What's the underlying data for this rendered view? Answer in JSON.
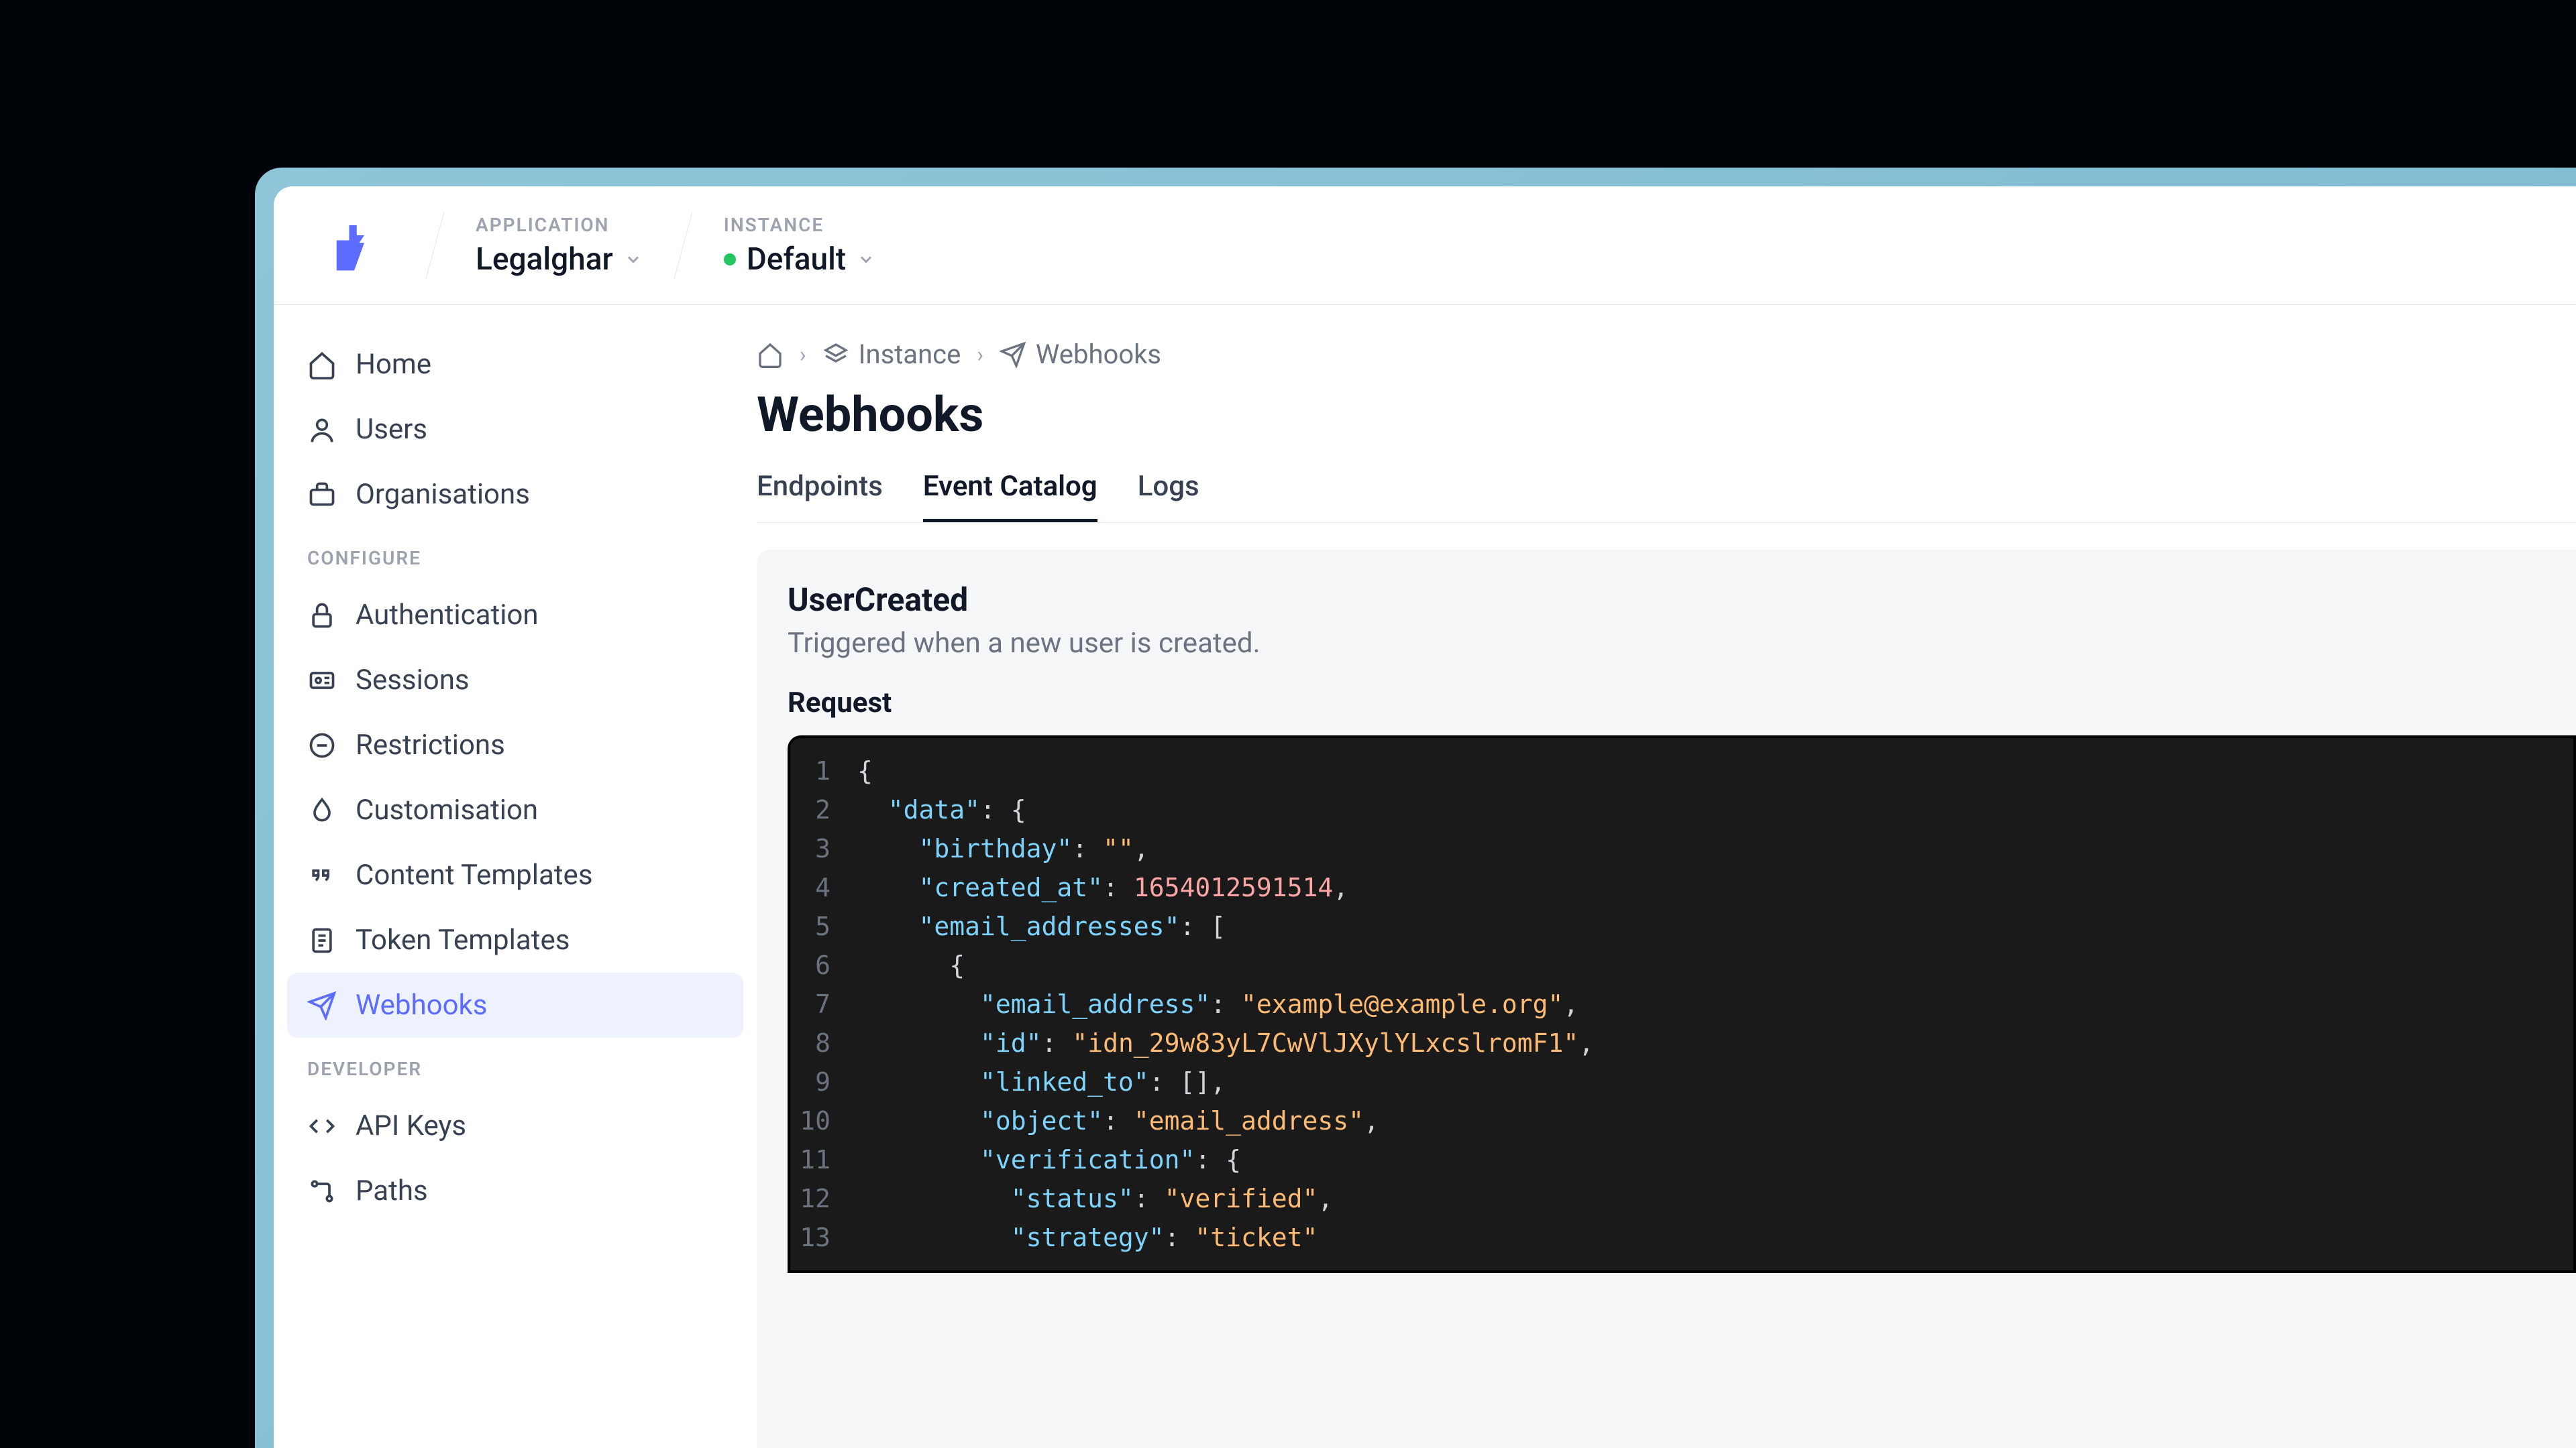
{
  "topbar": {
    "application_label": "APPLICATION",
    "application_value": "Legalghar",
    "instance_label": "INSTANCE",
    "instance_value": "Default"
  },
  "sidebar": {
    "main": [
      {
        "icon": "home",
        "label": "Home"
      },
      {
        "icon": "user",
        "label": "Users"
      },
      {
        "icon": "briefcase",
        "label": "Organisations"
      }
    ],
    "configure_label": "CONFIGURE",
    "configure": [
      {
        "icon": "lock",
        "label": "Authentication"
      },
      {
        "icon": "id",
        "label": "Sessions"
      },
      {
        "icon": "nope",
        "label": "Restrictions"
      },
      {
        "icon": "drop",
        "label": "Customisation"
      },
      {
        "icon": "quotes",
        "label": "Content Templates"
      },
      {
        "icon": "doc",
        "label": "Token Templates"
      },
      {
        "icon": "send",
        "label": "Webhooks",
        "active": true
      }
    ],
    "developer_label": "DEVELOPER",
    "developer": [
      {
        "icon": "code",
        "label": "API Keys"
      },
      {
        "icon": "paths",
        "label": "Paths"
      }
    ]
  },
  "breadcrumbs": {
    "instance": "Instance",
    "webhooks": "Webhooks"
  },
  "page": {
    "title": "Webhooks"
  },
  "tabs": [
    {
      "label": "Endpoints"
    },
    {
      "label": "Event Catalog",
      "active": true
    },
    {
      "label": "Logs"
    }
  ],
  "event": {
    "title": "UserCreated",
    "description": "Triggered when a new user is created.",
    "request_label": "Request"
  },
  "code": {
    "lines": [
      [
        {
          "t": "punct",
          "v": "{"
        }
      ],
      [
        {
          "t": "pad",
          "v": "  "
        },
        {
          "t": "key",
          "v": "\"data\""
        },
        {
          "t": "punct",
          "v": ": {"
        }
      ],
      [
        {
          "t": "pad",
          "v": "    "
        },
        {
          "t": "key",
          "v": "\"birthday\""
        },
        {
          "t": "punct",
          "v": ": "
        },
        {
          "t": "str",
          "v": "\"\""
        },
        {
          "t": "punct",
          "v": ","
        }
      ],
      [
        {
          "t": "pad",
          "v": "    "
        },
        {
          "t": "key",
          "v": "\"created_at\""
        },
        {
          "t": "punct",
          "v": ": "
        },
        {
          "t": "num",
          "v": "1654012591514"
        },
        {
          "t": "punct",
          "v": ","
        }
      ],
      [
        {
          "t": "pad",
          "v": "    "
        },
        {
          "t": "key",
          "v": "\"email_addresses\""
        },
        {
          "t": "punct",
          "v": ": ["
        }
      ],
      [
        {
          "t": "pad",
          "v": "      "
        },
        {
          "t": "punct",
          "v": "{"
        }
      ],
      [
        {
          "t": "pad",
          "v": "        "
        },
        {
          "t": "key",
          "v": "\"email_address\""
        },
        {
          "t": "punct",
          "v": ": "
        },
        {
          "t": "str",
          "v": "\"example@example.org\""
        },
        {
          "t": "punct",
          "v": ","
        }
      ],
      [
        {
          "t": "pad",
          "v": "        "
        },
        {
          "t": "key",
          "v": "\"id\""
        },
        {
          "t": "punct",
          "v": ": "
        },
        {
          "t": "str",
          "v": "\"idn_29w83yL7CwVlJXylYLxcslromF1\""
        },
        {
          "t": "punct",
          "v": ","
        }
      ],
      [
        {
          "t": "pad",
          "v": "        "
        },
        {
          "t": "key",
          "v": "\"linked_to\""
        },
        {
          "t": "punct",
          "v": ": [],"
        }
      ],
      [
        {
          "t": "pad",
          "v": "        "
        },
        {
          "t": "key",
          "v": "\"object\""
        },
        {
          "t": "punct",
          "v": ": "
        },
        {
          "t": "str",
          "v": "\"email_address\""
        },
        {
          "t": "punct",
          "v": ","
        }
      ],
      [
        {
          "t": "pad",
          "v": "        "
        },
        {
          "t": "key",
          "v": "\"verification\""
        },
        {
          "t": "punct",
          "v": ": {"
        }
      ],
      [
        {
          "t": "pad",
          "v": "          "
        },
        {
          "t": "key",
          "v": "\"status\""
        },
        {
          "t": "punct",
          "v": ": "
        },
        {
          "t": "str",
          "v": "\"verified\""
        },
        {
          "t": "punct",
          "v": ","
        }
      ],
      [
        {
          "t": "pad",
          "v": "          "
        },
        {
          "t": "key",
          "v": "\"strategy\""
        },
        {
          "t": "punct",
          "v": ": "
        },
        {
          "t": "str",
          "v": "\"ticket\""
        }
      ]
    ]
  }
}
